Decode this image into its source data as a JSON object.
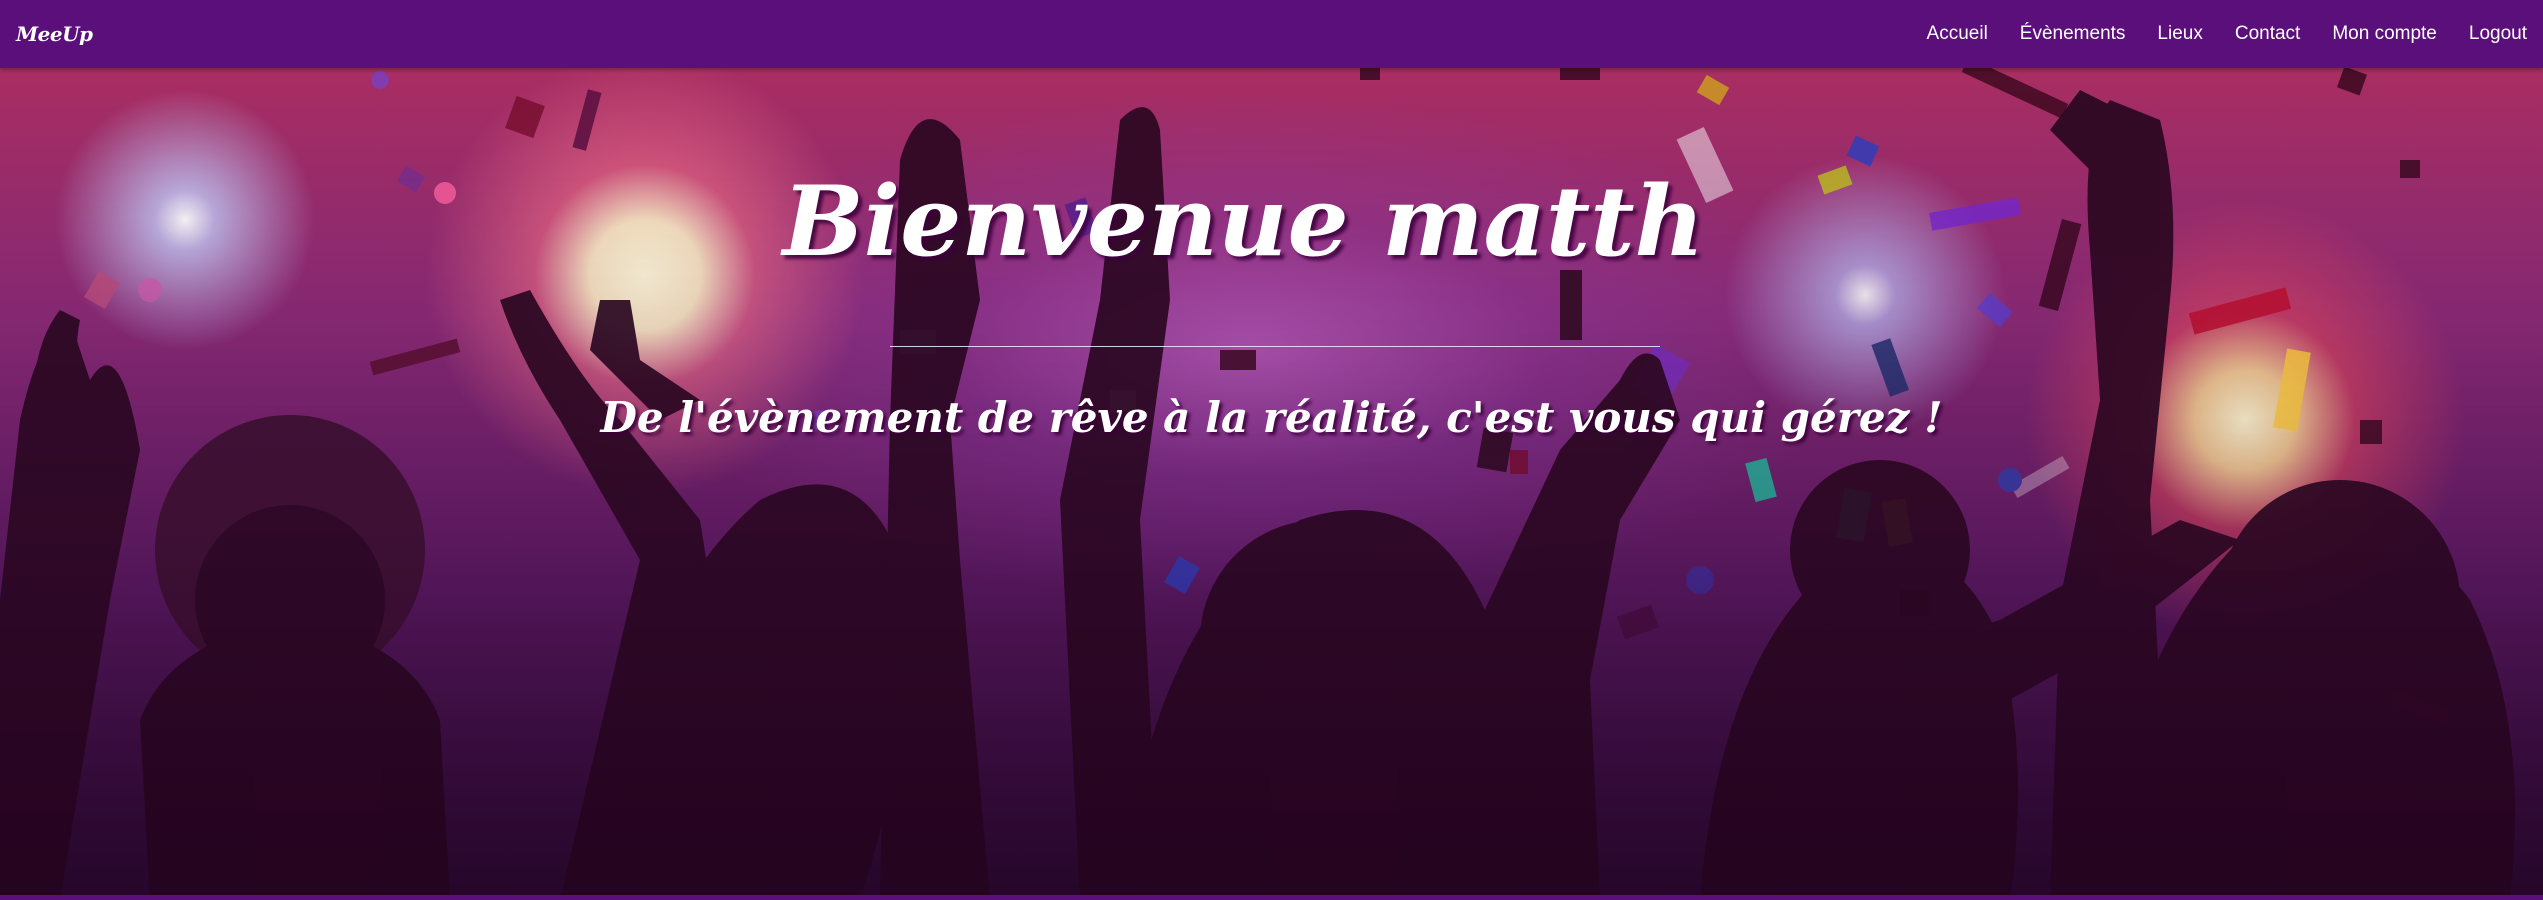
{
  "navbar": {
    "brand": "MeeUp",
    "links": [
      {
        "label": "Accueil"
      },
      {
        "label": "Évènements"
      },
      {
        "label": "Lieux"
      },
      {
        "label": "Contact"
      },
      {
        "label": "Mon compte"
      },
      {
        "label": "Logout"
      }
    ]
  },
  "hero": {
    "title": "Bienvenue matth",
    "subtitle": "De l'évènement de rêve à la réalité, c'est vous qui gérez !"
  },
  "colors": {
    "navbar_bg": "#5a0f7a",
    "text": "#ffffff"
  }
}
